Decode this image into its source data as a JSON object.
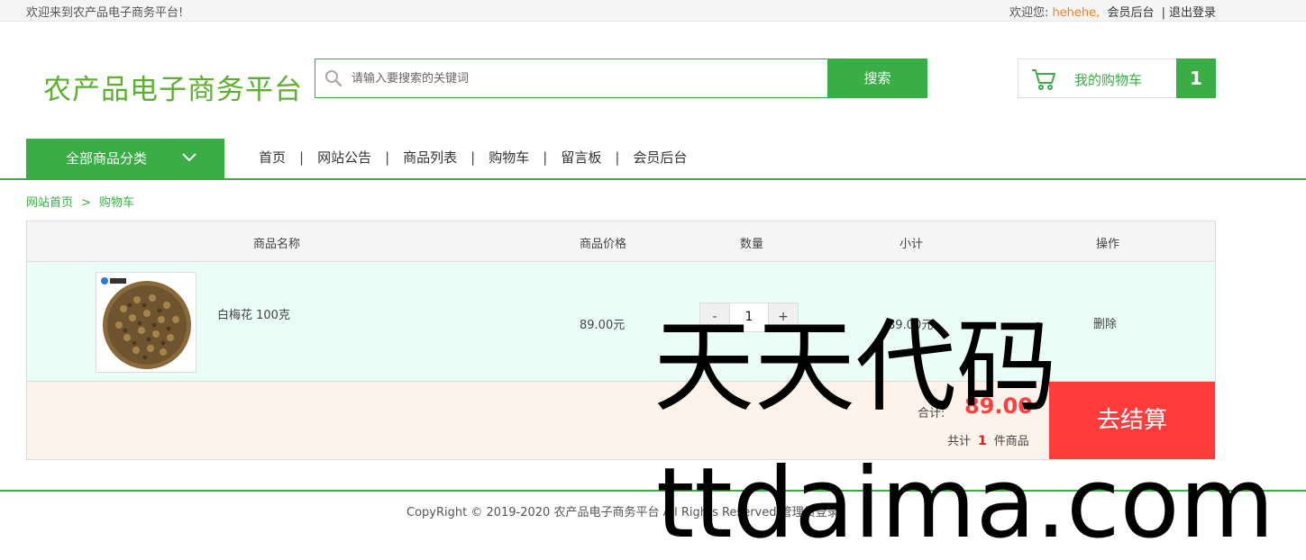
{
  "topbar": {
    "welcome": "欢迎来到农产品电子商务平台!",
    "greeting": "欢迎您:",
    "username": "hehehe,",
    "member_link": "会员后台",
    "separator": "|",
    "logout": "退出登录"
  },
  "header": {
    "logo": "农产品电子商务平台",
    "search_placeholder": "请输入要搜索的关键词",
    "search_button": "搜索",
    "cart_label": "我的购物车",
    "cart_count": "1"
  },
  "nav": {
    "category_button": "全部商品分类",
    "items": [
      "首页",
      "网站公告",
      "商品列表",
      "购物车",
      "留言板",
      "会员后台"
    ],
    "separator": "|"
  },
  "breadcrumb": {
    "home": "网站首页",
    "sep": ">",
    "current": "购物车"
  },
  "cart_table": {
    "headers": {
      "name": "商品名称",
      "price": "商品价格",
      "qty": "数量",
      "subtotal": "小计",
      "action": "操作"
    },
    "rows": [
      {
        "name": "白梅花 100克",
        "price": "89.00元",
        "qty": "1",
        "minus": "-",
        "plus": "+",
        "subtotal": "89.00元",
        "action": "删除"
      }
    ],
    "total_label": "合计:",
    "total_value": "89.00",
    "count_prefix": "共计",
    "count_value": "1",
    "count_suffix": "件商品",
    "checkout_button": "去结算"
  },
  "footer": {
    "copyright": "CopyRight © 2019-2020 农产品电子商务平台 All Rights Reserved 管理员登录"
  },
  "watermark": {
    "line1": "天天代码",
    "line2": "ttdaima.com"
  },
  "colors": {
    "brand_green": "#3aad44",
    "logo_green": "#5bb030",
    "username_orange": "#ff7e1a",
    "checkout_red": "#ff3c3c",
    "total_red": "#ff4040",
    "row_bg": "#eafdf7",
    "footer_row_bg": "#fdf3ea"
  },
  "icons": {
    "search": "search-icon",
    "cart": "cart-icon",
    "dropdown": "chevron-down-icon"
  }
}
